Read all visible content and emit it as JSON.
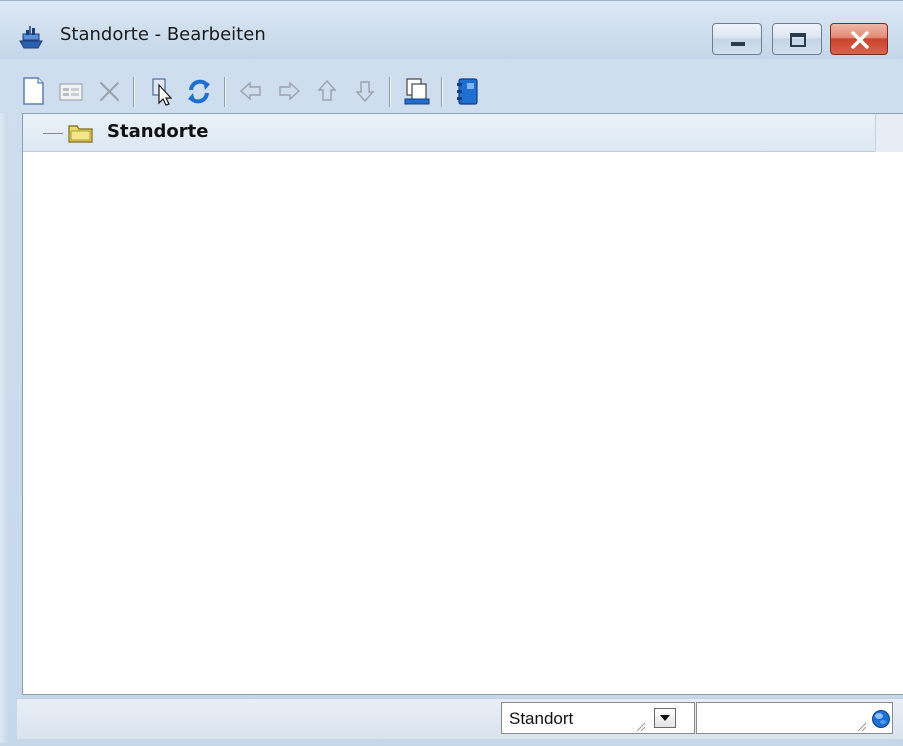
{
  "window": {
    "title": "Standorte - Bearbeiten",
    "app_icon": "ship-icon",
    "caption_buttons": [
      "minimize-icon",
      "maximize-icon",
      "close-icon"
    ]
  },
  "toolbar": {
    "buttons": [
      {
        "name": "new-document-icon",
        "enabled": true
      },
      {
        "name": "form-view-icon",
        "enabled": false
      },
      {
        "name": "delete-icon",
        "enabled": false
      },
      {
        "name": "select-pointer-icon",
        "enabled": true
      },
      {
        "name": "refresh-icon",
        "enabled": true
      },
      {
        "name": "arrow-left-icon",
        "enabled": false
      },
      {
        "name": "arrow-right-icon",
        "enabled": false
      },
      {
        "name": "arrow-up-icon",
        "enabled": false
      },
      {
        "name": "arrow-down-icon",
        "enabled": false
      },
      {
        "name": "copy-records-icon",
        "enabled": true
      },
      {
        "name": "book-icon",
        "enabled": true
      }
    ]
  },
  "tree": {
    "root_label": "Standorte",
    "root_icon": "folder-icon"
  },
  "statusbar": {
    "combo_value": "Standort",
    "search_value": "",
    "globe_icon": "globe-icon"
  },
  "colors": {
    "frame": "#cfdeee",
    "tree_header": "#dde8f3",
    "close_button": "#c9432c",
    "icon_blue": "#1f6fd1"
  }
}
